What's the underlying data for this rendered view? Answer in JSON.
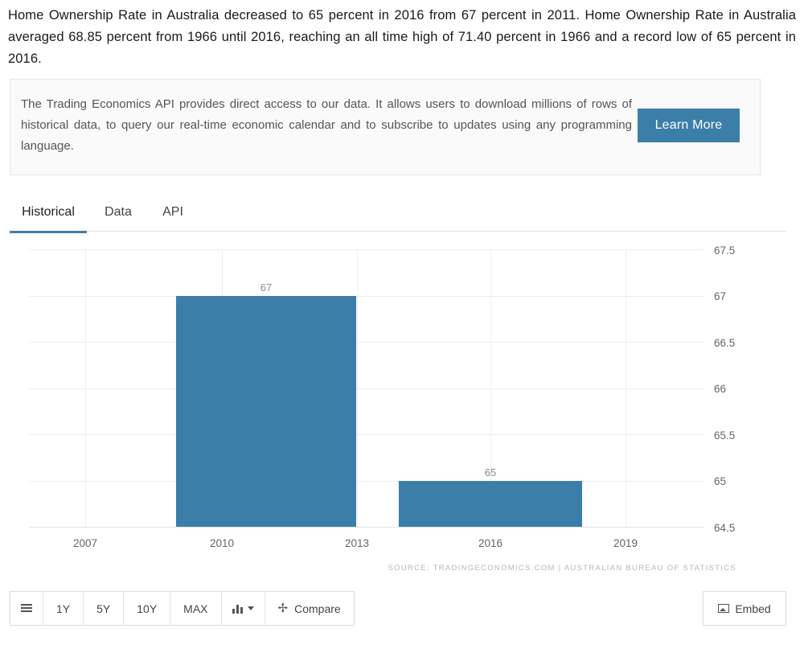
{
  "intro": {
    "paragraph": "Home Ownership Rate in Australia decreased to 65 percent in 2016 from 67 percent in 2011. Home Ownership Rate in Australia averaged 68.85 percent from 1966 until 2016, reaching an all time high of 71.40 percent in 1966 and a record low of 65 percent in 2016."
  },
  "promo": {
    "text": "The Trading Economics API provides direct access to our data. It allows users to download millions of rows of historical data, to query our real-time economic calendar and to subscribe to updates using any programming language.",
    "button_label": "Learn More",
    "button_color": "#3b7ea8"
  },
  "tabs": [
    {
      "label": "Historical",
      "active": true
    },
    {
      "label": "Data",
      "active": false
    },
    {
      "label": "API",
      "active": false
    }
  ],
  "chart_data": {
    "type": "bar",
    "title": "",
    "subtitle": "",
    "xlabel": "",
    "ylabel": "",
    "categories": [
      "2011",
      "2016"
    ],
    "values": [
      67,
      65
    ],
    "bar_labels": [
      "67",
      "65"
    ],
    "bar_color": "#3b7ea8",
    "ylim": [
      64.5,
      67.5
    ],
    "yticks": [
      "67.5",
      "67",
      "66.5",
      "66",
      "65.5",
      "65",
      "64.5"
    ],
    "ytick_values": [
      67.5,
      67,
      66.5,
      66,
      65.5,
      65,
      64.5
    ],
    "xticks": [
      "2007",
      "2010",
      "2013",
      "2016",
      "2019"
    ],
    "xtick_values": [
      2007,
      2010,
      2013,
      2016,
      2019
    ],
    "grid": true,
    "legend": "none",
    "source": "SOURCE: TRADINGECONOMICS.COM  |  AUSTRALIAN BUREAU OF STATISTICS"
  },
  "toolbar": {
    "ranges": [
      "1Y",
      "5Y",
      "10Y",
      "MAX"
    ],
    "chart_type_label": "",
    "compare_label": "Compare",
    "embed_label": "Embed",
    "list_icon": "list-icon",
    "bar_chart_icon": "bar-chart-icon",
    "shuffle_icon": "shuffle-icon",
    "image_icon": "image-icon"
  }
}
